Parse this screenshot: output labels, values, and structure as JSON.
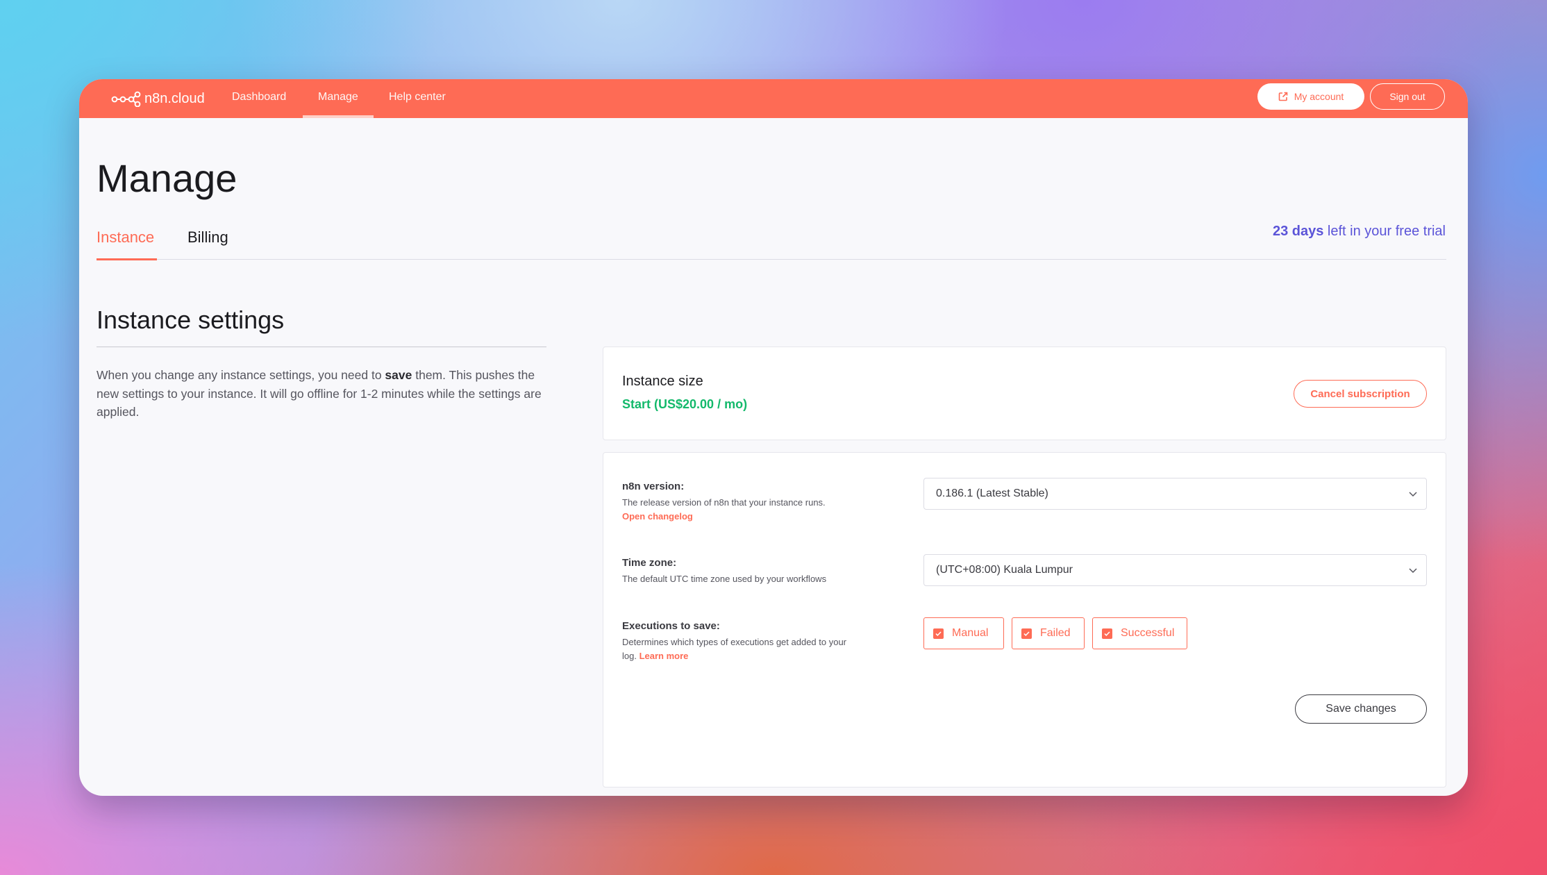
{
  "nav": {
    "logo_text": "n8n.cloud",
    "items": [
      {
        "label": "Dashboard",
        "active": false
      },
      {
        "label": "Manage",
        "active": true
      },
      {
        "label": "Help center",
        "active": false
      }
    ],
    "account_label": "My account",
    "signout_label": "Sign out"
  },
  "page": {
    "title": "Manage",
    "tabs": [
      {
        "label": "Instance",
        "active": true
      },
      {
        "label": "Billing",
        "active": false
      }
    ],
    "trial": {
      "days": "23 days",
      "suffix": " left in your free trial"
    }
  },
  "instance_settings": {
    "title": "Instance settings",
    "desc_before": "When you change any instance settings, you need to ",
    "desc_bold": "save",
    "desc_after": " them. This pushes the new settings to your instance. It will go offline for 1-2 minutes while the settings are applied."
  },
  "instance_size": {
    "title": "Instance size",
    "plan": "Start (US$20.00 / mo)",
    "cancel_label": "Cancel subscription"
  },
  "settings": {
    "version": {
      "label": "n8n version:",
      "help": "The release version of n8n that your instance runs.",
      "link": "Open changelog",
      "value": "0.186.1 (Latest Stable)"
    },
    "timezone": {
      "label": "Time zone:",
      "help": "The default UTC time zone used by your workflows",
      "value": "(UTC+08:00) Kuala Lumpur"
    },
    "executions": {
      "label": "Executions to save:",
      "help": "Determines which types of executions get added to your log.",
      "link": "Learn more",
      "options": [
        {
          "label": "Manual",
          "checked": true
        },
        {
          "label": "Failed",
          "checked": true
        },
        {
          "label": "Successful",
          "checked": true
        }
      ]
    },
    "save_label": "Save changes"
  },
  "colors": {
    "brand": "#fe6b55",
    "trial": "#5b54d8",
    "plan": "#13b96b"
  }
}
